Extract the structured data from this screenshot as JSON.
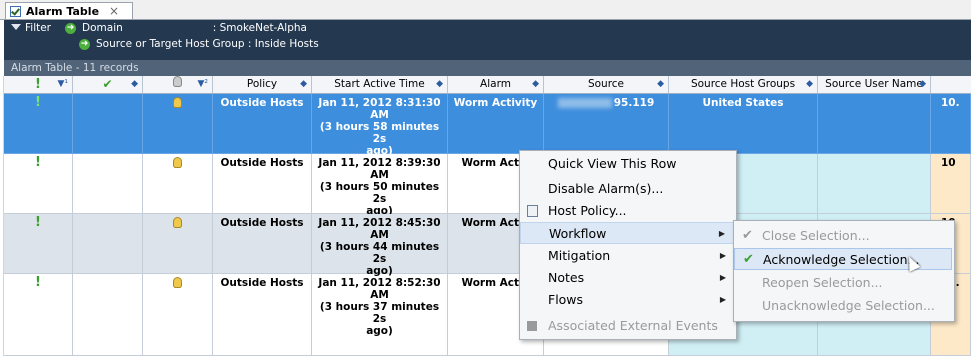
{
  "tab": {
    "title": "Alarm Table",
    "close": "×"
  },
  "filter": {
    "label": "Filter",
    "domain_label": "Domain",
    "domain_value": ": SmokeNet-Alpha",
    "group_line": "Source or Target Host Group : Inside Hosts"
  },
  "records": "Alarm Table - 11 records",
  "columns": {
    "c1_sort": "▼¹",
    "c3_sort": "▼²",
    "policy": "Policy",
    "start": "Start Active Time",
    "alarm": "Alarm",
    "source": "Source",
    "shg": "Source Host Groups",
    "sun": "Source User Name"
  },
  "rows": [
    {
      "policy": "Outside Hosts",
      "start1": "Jan 11, 2012 8:31:30",
      "start2": "AM",
      "start3": "(3 hours 58 minutes 2s",
      "start4": "ago)",
      "alarm": "Worm Activity",
      "source": "95.119",
      "shg": "United States",
      "last": "10."
    },
    {
      "policy": "Outside Hosts",
      "start1": "Jan 11, 2012 8:39:30",
      "start2": "AM",
      "start3": "(3 hours 50 minutes 2s",
      "start4": "ago)",
      "alarm": "Worm Activ",
      "source": "",
      "shg": "d States",
      "last": "10"
    },
    {
      "policy": "Outside Hosts",
      "start1": "Jan 11, 2012 8:45:30",
      "start2": "AM",
      "start3": "(3 hours 44 minutes 2s",
      "start4": "ago)",
      "alarm": "Worm Activ",
      "source": "",
      "shg": "",
      "last": "10"
    },
    {
      "policy": "Outside Hosts",
      "start1": "Jan 11, 2012 8:52:30",
      "start2": "AM",
      "start3": "(3 hours 37 minutes 2s",
      "start4": "ago)",
      "alarm": "Worm Activ",
      "source": "",
      "shg": "",
      "last": "10."
    }
  ],
  "menu": {
    "quick_view": "Quick View This Row",
    "disable": "Disable Alarm(s)...",
    "host_policy": "Host Policy...",
    "workflow": "Workflow",
    "mitigation": "Mitigation",
    "notes": "Notes",
    "flows": "Flows",
    "assoc": "Associated External Events"
  },
  "submenu": {
    "close": "Close Selection...",
    "ack": "Acknowledge Selection...",
    "reopen": "Reopen Selection...",
    "unack": "Unacknowledge Selection..."
  },
  "colors": {
    "header": "#24384f",
    "selected": "#3e8ede",
    "accent_green": "#3aa12e"
  }
}
